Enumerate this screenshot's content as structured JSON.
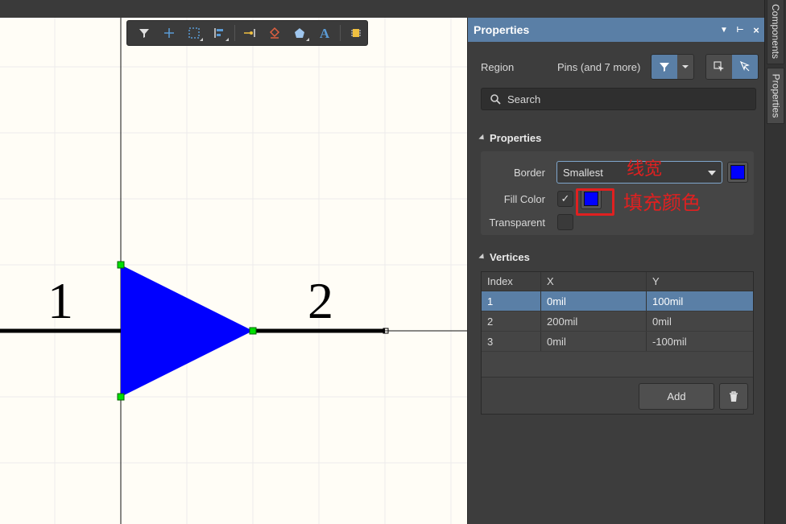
{
  "canvas": {
    "pin_labels": [
      "1",
      "2"
    ],
    "fill_color": "#0000ff",
    "handle_color": "#00e000"
  },
  "toolbar": {
    "icons": [
      "filter-icon",
      "cross-icon",
      "select-rect-icon",
      "align-icon",
      "pin-icon",
      "eraser-icon",
      "polygon-icon",
      "text-icon",
      "component-icon"
    ]
  },
  "panel": {
    "title": "Properties",
    "region_label": "Region",
    "region_value": "Pins (and 7 more)",
    "search_placeholder": "Search",
    "properties_section": "Properties",
    "border_label": "Border",
    "border_value": "Smallest",
    "border_color": "#0000ff",
    "fill_color_label": "Fill Color",
    "fill_checked": "✓",
    "fill_color": "#0000ff",
    "transparent_label": "Transparent",
    "vertices_section": "Vertices",
    "annotation_border": "线宽",
    "annotation_fill": "填充颜色",
    "table": {
      "headers": [
        "Index",
        "X",
        "Y"
      ],
      "rows": [
        [
          "1",
          "0mil",
          "100mil"
        ],
        [
          "2",
          "200mil",
          "0mil"
        ],
        [
          "3",
          "0mil",
          "-100mil"
        ]
      ]
    },
    "add_label": "Add"
  },
  "sidetabs": {
    "components": "Components",
    "properties": "Properties"
  },
  "colors": {
    "accent": "#5a7fa6",
    "annotation": "#e02020"
  }
}
